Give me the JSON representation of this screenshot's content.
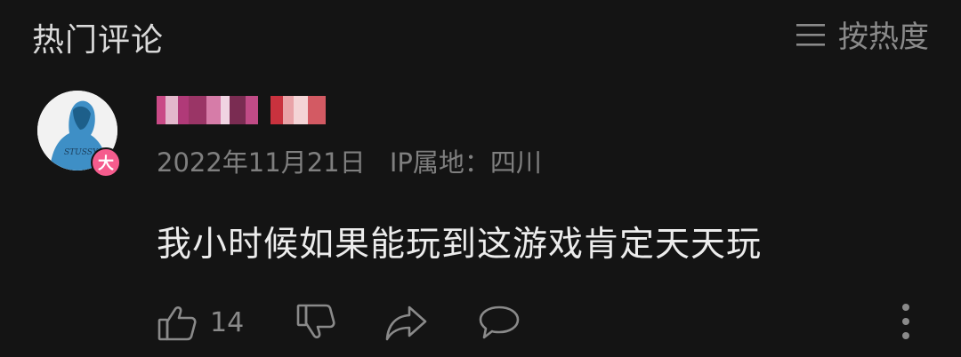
{
  "header": {
    "title": "热门评论",
    "sort_label": "按热度",
    "sort_icon": "menu-lines-icon"
  },
  "comment": {
    "avatar_badge": "大",
    "date": "2022年11月21日",
    "ip_location": "IP属地：四川",
    "text": "我小时候如果能玩到这游戏肯定天天玩",
    "avatar_print": "STUSSY",
    "like_count": "14"
  },
  "icons": {
    "like": "thumbs-up-icon",
    "dislike": "thumbs-down-icon",
    "share": "share-icon",
    "reply": "reply-bubble-icon",
    "more": "more-vertical-icon"
  },
  "colors": {
    "background": "#141414",
    "badge": "#f55c8d",
    "muted": "#8a8a8a"
  }
}
